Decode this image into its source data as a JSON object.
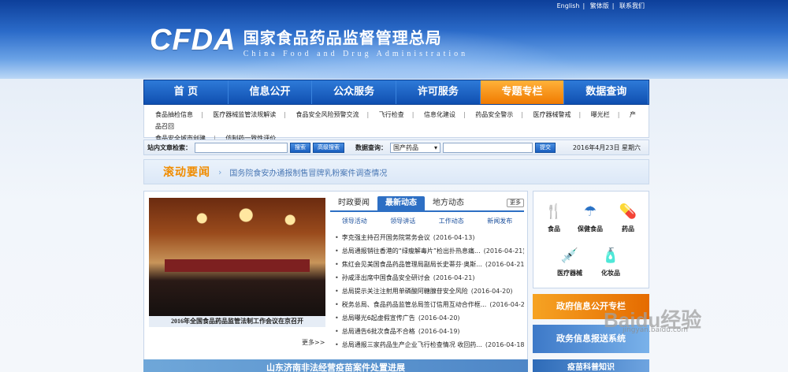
{
  "top_links": [
    "English",
    "繁体版",
    "联系我们"
  ],
  "logo": {
    "mark": "CFDA",
    "name_cn": "国家食品药品监督管理总局",
    "name_en": "China Food and Drug Administration"
  },
  "nav": {
    "items": [
      "首  页",
      "信息公开",
      "公众服务",
      "许可服务",
      "专题专栏",
      "数据查询"
    ],
    "active_index": 4
  },
  "subnav": {
    "row1": [
      "食品抽检信息",
      "医疗器械监管法规解读",
      "食品安全风险预警交流",
      "飞行检查",
      "信息化建设",
      "药品安全警示",
      "医疗器械警戒",
      "曝光栏",
      "产品召回"
    ],
    "row2": [
      "食品安全城市创建",
      "仿制药一致性评价"
    ]
  },
  "search": {
    "site_label": "站内文章检索：",
    "search_btn": "搜索",
    "advanced_btn": "高级搜索",
    "data_label": "数据查询：",
    "category": "国产药品",
    "submit_btn": "提交",
    "date": "2016年4月23日  星期六"
  },
  "scroll_news": {
    "title": "滚动要闻",
    "headline": "国务院食安办通报制售冒牌乳粉案件调查情况"
  },
  "photo": {
    "caption": "2016年全国食品药品监管法制工作会议在京召开",
    "more": "更多>>"
  },
  "news_tabs": {
    "items": [
      "时政要闻",
      "最新动态",
      "地方动态"
    ],
    "active_index": 1,
    "more": "更多"
  },
  "sub_tabs": [
    "领导活动",
    "领导讲话",
    "工作动态",
    "新闻发布"
  ],
  "news": [
    {
      "title": "李克强主持召开国务院常务会议",
      "date": "(2016-04-13)"
    },
    {
      "title": "总局通报销往香港的“绿瘦解毒片”检出扑热息痛...",
      "date": "(2016-04-21)"
    },
    {
      "title": "焦红会见美国食品药品管理局副局长史蒂芬·奥斯...",
      "date": "(2016-04-21)"
    },
    {
      "title": "孙咸泽出席中国食品安全研讨会",
      "date": "(2016-04-21)"
    },
    {
      "title": "总局提示关注注射用单磷酸阿糖腺苷安全风险",
      "date": "(2016-04-20)"
    },
    {
      "title": "税务总局、食品药品监管总局签订信用互动合作框...",
      "date": "(2016-04-20)"
    },
    {
      "title": "总局曝光6起虚假宣传广告",
      "date": "(2016-04-20)"
    },
    {
      "title": "总局通告6批次食品不合格",
      "date": "(2016-04-19)"
    },
    {
      "title": "总局通报三家药品生产企业飞行检查情况 收回药...",
      "date": "(2016-04-18)"
    }
  ],
  "services": [
    {
      "label": "食品",
      "icon": "fork-knife-icon",
      "glyph": "🍴"
    },
    {
      "label": "保健食品",
      "icon": "health-food-icon",
      "glyph": "☂"
    },
    {
      "label": "药品",
      "icon": "pill-icon",
      "glyph": "💊"
    },
    {
      "label": "医疗器械",
      "icon": "syringe-icon",
      "glyph": "💉"
    },
    {
      "label": "化妆品",
      "icon": "cosmetics-icon",
      "glyph": "🧴"
    }
  ],
  "side_banners": [
    "政府信息公开专栏",
    "政务信息报送系统"
  ],
  "bottom_banners": [
    "山东济南非法经营疫苗案件处置进展",
    "疫苗科普知识"
  ],
  "watermark": {
    "text": "Baidu经验",
    "url": "jingyan.baidu.com"
  },
  "colors": {
    "nav_blue": "#1a5fbf",
    "nav_active": "#f08c00",
    "title_orange": "#f08c00"
  }
}
